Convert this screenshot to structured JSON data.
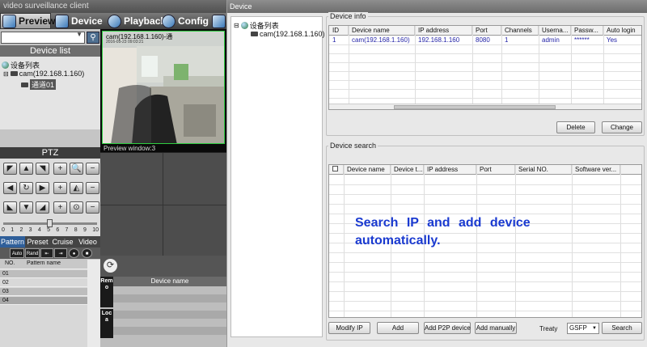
{
  "app": {
    "title": "video surveillance client"
  },
  "tabs": [
    {
      "label": "Preview",
      "icon": "camera-icon"
    },
    {
      "label": "Device",
      "icon": "device-icon"
    },
    {
      "label": "Playback",
      "icon": "film-icon"
    },
    {
      "label": "Config",
      "icon": "gear-icon"
    }
  ],
  "left": {
    "device_list_title": "Device list",
    "tree": {
      "root": "设备列表",
      "device": "cam(192.168.1.160)",
      "channel": "通道01"
    },
    "ptz_title": "PTZ",
    "speed_ticks": [
      "0",
      "1",
      "2",
      "3",
      "4",
      "5",
      "6",
      "7",
      "8",
      "9",
      "10"
    ],
    "speed": 5,
    "subtabs": [
      "Pattern",
      "Preset",
      "Cruise",
      "Video"
    ],
    "toolbar": {
      "auto": "Auto",
      "rand": "Rand"
    },
    "pattern_headers": [
      "NO.",
      "Pattern name"
    ],
    "pattern_rows": [
      "01",
      "02",
      "03",
      "04"
    ]
  },
  "video": {
    "overlay_title": "cam(192.168.1.160)-通",
    "timestamp": "2016-05-23 09:03:21",
    "window_label": "Preview window:3"
  },
  "bottom": {
    "column_device_name": "Device name",
    "side_tabs": [
      "Remo",
      "Loca"
    ]
  },
  "dialog": {
    "title": "Device",
    "tree": {
      "root": "设备列表",
      "device": "cam(192.168.1.160)"
    },
    "device_info": {
      "label": "Device info",
      "headers": [
        "ID",
        "Device name",
        "IP address",
        "Port",
        "Channels",
        "Userna...",
        "Passw...",
        "Auto login"
      ],
      "rows": [
        [
          "1",
          "cam(192.168.1.160)",
          "192.168.1.160",
          "8080",
          "1",
          "admin",
          "******",
          "Yes"
        ]
      ],
      "buttons": {
        "delete": "Delete",
        "change": "Change"
      }
    },
    "device_search": {
      "label": "Device search",
      "headers": [
        "Device name",
        "Device t...",
        "IP address",
        "Port",
        "Serial NO.",
        "Software ver..."
      ],
      "overlay": "Search IP and add device automatically.",
      "buttons": {
        "modify_ip": "Modify IP",
        "add": "Add",
        "add_p2p": "Add P2P device",
        "add_manually": "Add manually",
        "search": "Search"
      },
      "treaty_label": "Treaty",
      "treaty_value": "GSFP"
    }
  }
}
